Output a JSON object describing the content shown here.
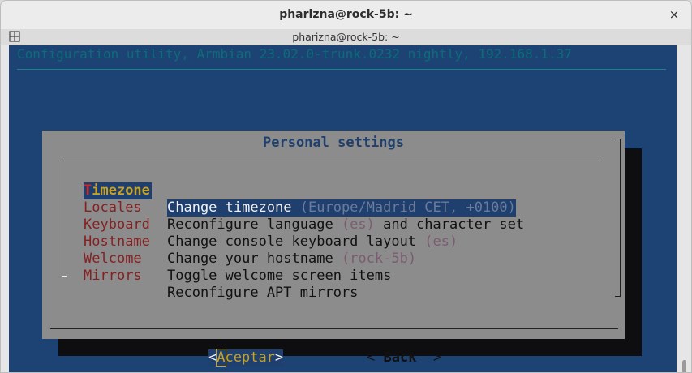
{
  "window": {
    "title": "pharizna@rock-5b: ~",
    "close_glyph": "×"
  },
  "tab": {
    "title": "pharizna@rock-5b: ~"
  },
  "terminal": {
    "backtitle": "Configuration utility, Armbian 23.02.0-trunk.0232 nightly, 192.168.1.37"
  },
  "dialog": {
    "title": "Personal settings",
    "items": [
      {
        "tag_first": "T",
        "tag_rest": "imezone",
        "desc": "Change timezone ",
        "hint": "(Europe/Madrid CET, +0100)",
        "selected": true
      },
      {
        "tag_first": "L",
        "tag_rest": "ocales",
        "desc": "Reconfigure language ",
        "hint": "(es)",
        "desc2": " and character set"
      },
      {
        "tag_first": "K",
        "tag_rest": "eyboard",
        "desc": "Change console keyboard layout ",
        "hint": "(es)",
        "desc2": ""
      },
      {
        "tag_first": "H",
        "tag_rest": "ostname",
        "desc": "Change your hostname ",
        "hint": "(rock-5b)",
        "desc2": ""
      },
      {
        "tag_first": "W",
        "tag_rest": "elcome",
        "desc": "Toggle welcome screen items",
        "hint": "",
        "desc2": ""
      },
      {
        "tag_first": "M",
        "tag_rest": "irrors",
        "desc": "Reconfigure APT mirrors",
        "hint": "",
        "desc2": ""
      }
    ],
    "ok_button": {
      "open": "<",
      "key": "A",
      "rest": "ceptar",
      "close": ">"
    },
    "back_button": {
      "open": "< ",
      "label": "Back",
      "close": "  >"
    }
  },
  "colors": {
    "terminal_bg": "#1d4374",
    "dialog_bg": "#8c8c8c",
    "highlight_bg": "#1f3f6e",
    "tag_color": "#861f20",
    "highlight_tag": "#c8a222"
  }
}
